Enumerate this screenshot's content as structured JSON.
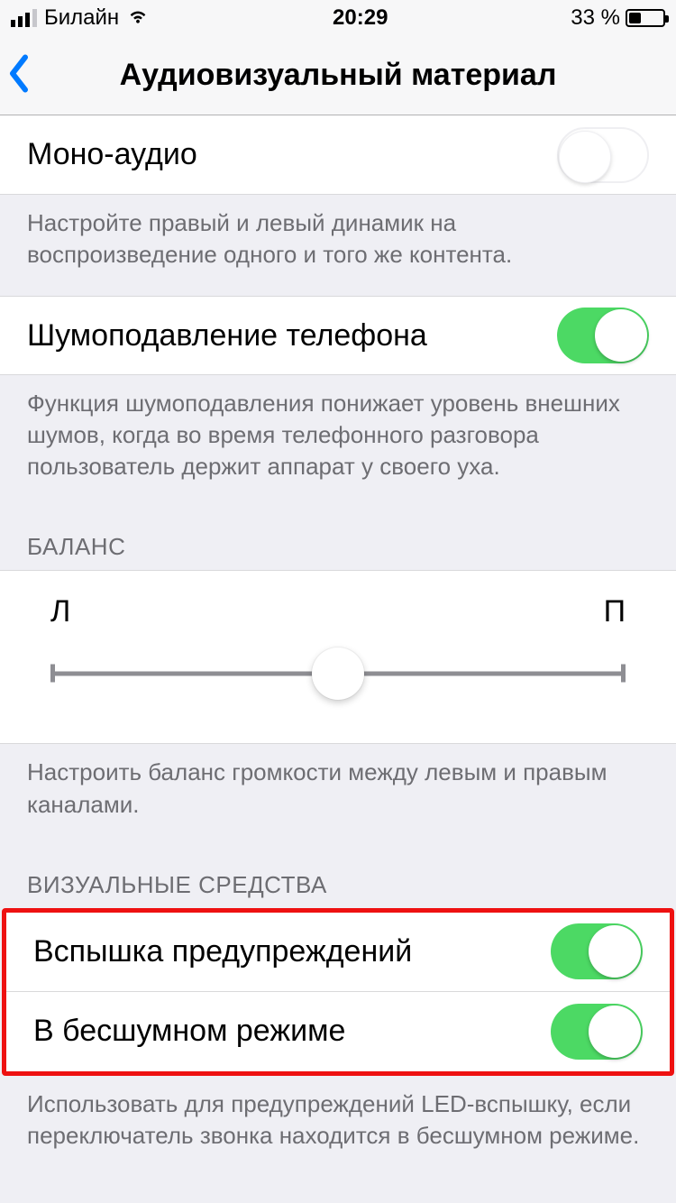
{
  "status": {
    "carrier": "Билайн",
    "time": "20:29",
    "battery_text": "33 %"
  },
  "nav": {
    "title": "Аудиовизуальный материал"
  },
  "mono": {
    "label": "Моно-аудио",
    "footer": "Настройте правый и левый динамик на воспроизведение одного и того же контента."
  },
  "noise": {
    "label": "Шумоподавление телефона",
    "footer": "Функция шумоподавления понижает уровень внешних шумов, когда во время телефонного разговора пользователь держит аппарат у своего уха."
  },
  "balance": {
    "header": "БАЛАНС",
    "left_label": "Л",
    "right_label": "П",
    "footer": "Настроить баланс громкости между левым и правым каналами."
  },
  "visual": {
    "header": "ВИЗУАЛЬНЫЕ СРЕДСТВА",
    "flash_label": "Вспышка предупреждений",
    "silent_label": "В бесшумном режиме",
    "footer": "Использовать для предупреждений LED-вспышку, если переключатель звонка находится в бесшумном режиме."
  }
}
